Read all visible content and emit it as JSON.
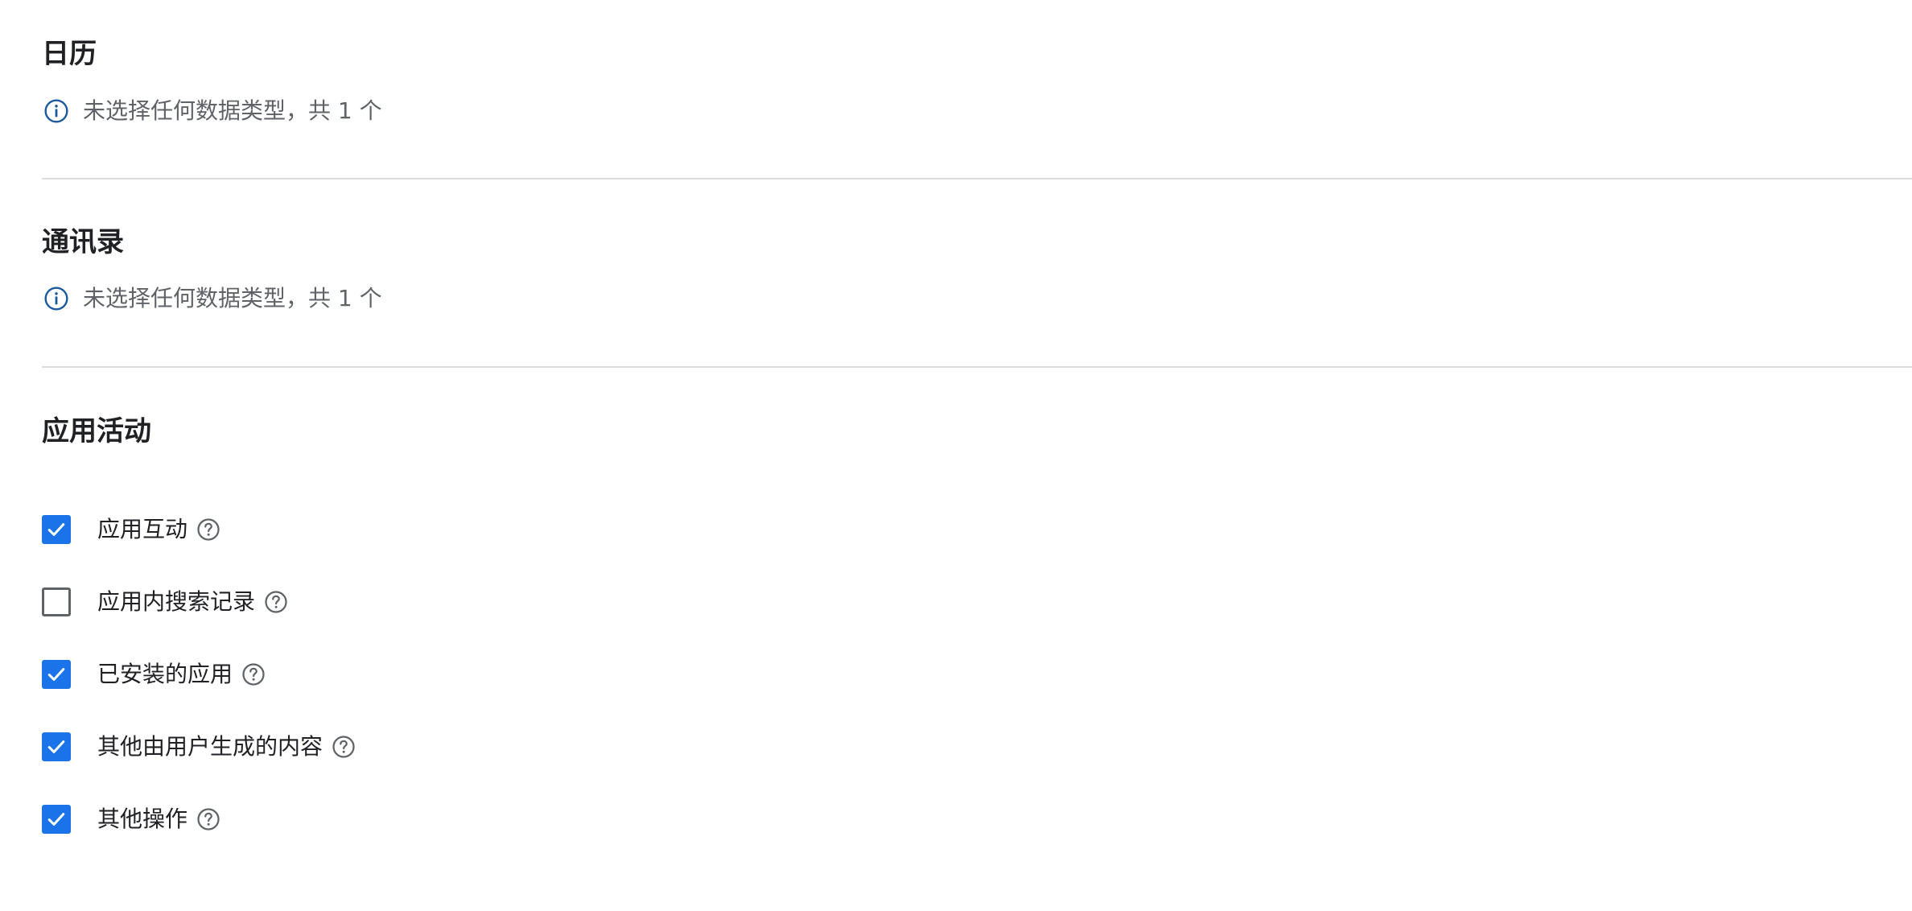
{
  "sections": {
    "calendar": {
      "title": "日历",
      "info_text": "未选择任何数据类型，共 1 个",
      "info_icon": "info-icon"
    },
    "contacts": {
      "title": "通讯录",
      "info_text": "未选择任何数据类型，共 1 个",
      "info_icon": "info-icon"
    },
    "app_activity": {
      "title": "应用活动",
      "items": [
        {
          "label": "应用互动",
          "checked": true,
          "help_icon": "help-circle-icon"
        },
        {
          "label": "应用内搜索记录",
          "checked": false,
          "help_icon": "help-circle-icon"
        },
        {
          "label": "已安装的应用",
          "checked": true,
          "help_icon": "help-circle-icon"
        },
        {
          "label": "其他由用户生成的内容",
          "checked": true,
          "help_icon": "help-circle-icon"
        },
        {
          "label": "其他操作",
          "checked": true,
          "help_icon": "help-circle-icon"
        }
      ]
    }
  },
  "colors": {
    "checkbox_checked": "#1a73e8",
    "checkbox_unchecked_border": "#5f6368",
    "info_icon": "#1a5a9c",
    "divider": "#dadce0"
  }
}
